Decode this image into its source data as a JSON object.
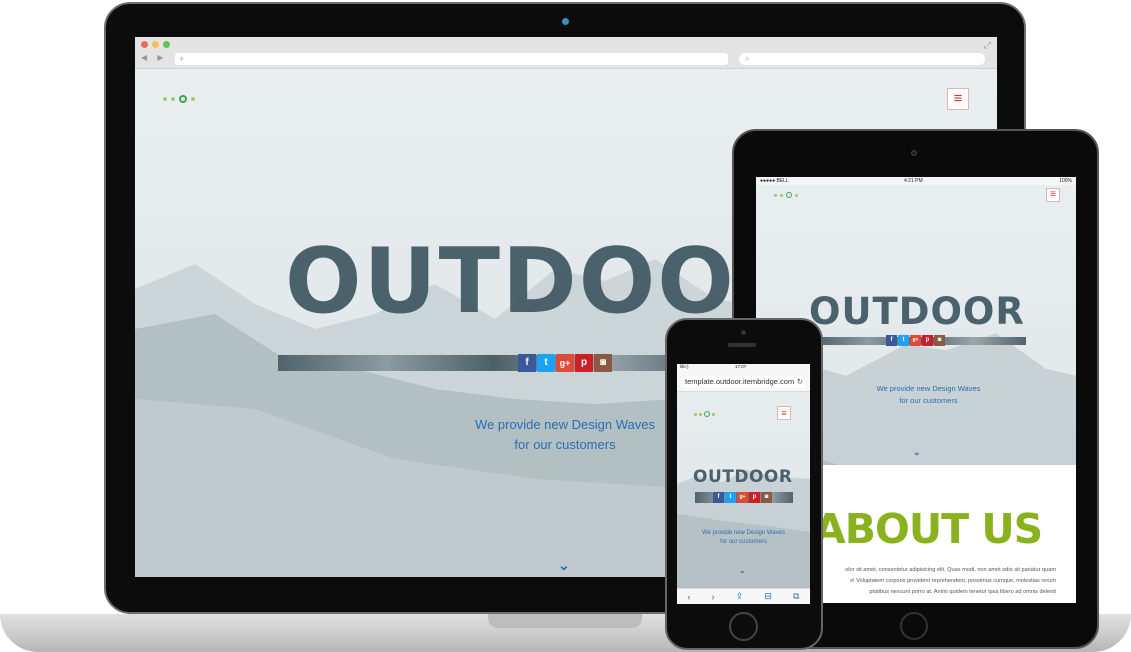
{
  "colors": {
    "accent_blue": "#2a6db5",
    "menu_red": "#dd3333",
    "about_green": "#8ab21e",
    "logo_green": "#3aa54a"
  },
  "laptop": {
    "browser": {
      "nav_label": "◀ ▶",
      "url_text": "+",
      "search_icon": "search-icon",
      "expand_icon": "expand-icon"
    },
    "site": {
      "menu_icon": "≡",
      "hero_title": "OUTDOOR",
      "social": [
        "f",
        "t",
        "g+",
        "p",
        "◙"
      ],
      "tagline_line1": "We provide new Design Waves",
      "tagline_line2": "for our customers",
      "scroll_icon": "⌄"
    }
  },
  "tablet": {
    "status": {
      "carrier": "●●●●● BELL",
      "time": "4:21 PM",
      "battery": "100%"
    },
    "site": {
      "menu_icon": "≡",
      "hero_title": "OUTDOOR",
      "social": [
        "f",
        "t",
        "g+",
        "p",
        "◙"
      ],
      "tagline_line1": "We provide new Design Waves",
      "tagline_line2": "for our customers",
      "scroll_icon": "⌄",
      "about_title": "ABOUT US",
      "about_lines": [
        "olor sit amet, consectetur adipisicing elit. Quas modi, non amet odio sit pariatur quam",
        "s! Voluptatem corporis provident reprehendent, possimus cumque, molestias rerum",
        "ptatibus nescunt porro at. Animi quidem tenetur ipsa libero ad omnis delenit"
      ]
    }
  },
  "phone": {
    "status": {
      "carrier": "life:)",
      "time": "17:07"
    },
    "url": "template.outdoor.itembridge.com",
    "reload_icon": "↻",
    "site": {
      "menu_icon": "≡",
      "hero_title": "OUTDOOR",
      "social": [
        "f",
        "t",
        "g+",
        "p",
        "◙"
      ],
      "tagline_line1": "We provide new Design Waves",
      "tagline_line2": "for our customers",
      "scroll_icon": "⌄"
    },
    "toolbar": [
      "‹",
      "›",
      "⇪",
      "⊟",
      "⧉"
    ]
  }
}
